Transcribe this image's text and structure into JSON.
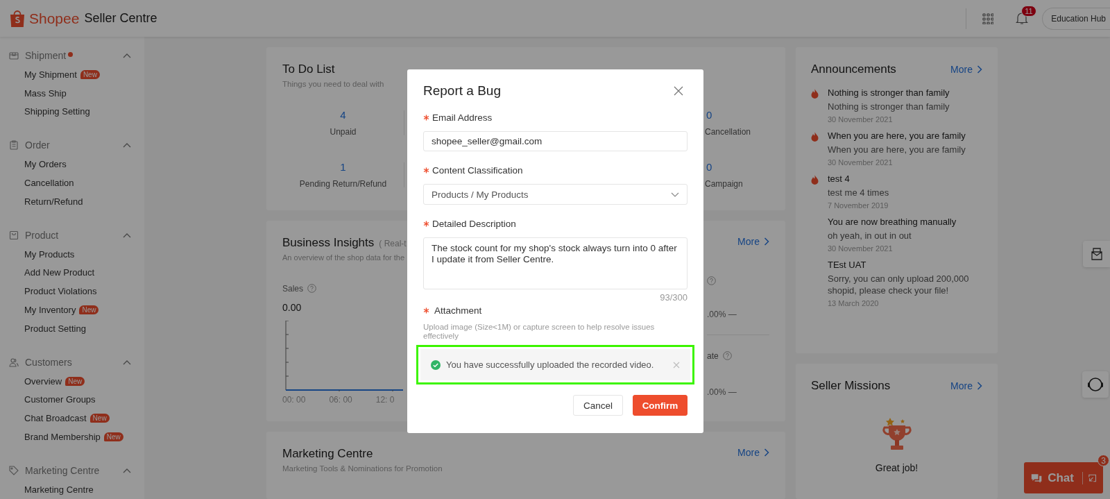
{
  "header": {
    "brand": "Shopee",
    "product": "Seller Centre",
    "notifications": "11",
    "education": "Education Hub"
  },
  "sidebar": [
    {
      "title": "Shipment",
      "dot": true,
      "expanded": true,
      "items": [
        {
          "label": "My Shipment",
          "badge": "New"
        },
        {
          "label": "Mass Ship"
        },
        {
          "label": "Shipping Setting"
        }
      ]
    },
    {
      "title": "Order",
      "dot": false,
      "expanded": true,
      "items": [
        {
          "label": "My Orders"
        },
        {
          "label": "Cancellation"
        },
        {
          "label": "Return/Refund"
        }
      ]
    },
    {
      "title": "Product",
      "dot": false,
      "expanded": true,
      "items": [
        {
          "label": "My Products"
        },
        {
          "label": "Add New Product"
        },
        {
          "label": "Product Violations"
        },
        {
          "label": "My Inventory",
          "badge": "New"
        },
        {
          "label": "Product Setting"
        }
      ]
    },
    {
      "title": "Customers",
      "dot": false,
      "expanded": true,
      "items": [
        {
          "label": "Overview",
          "badge": "New"
        },
        {
          "label": "Customer Groups"
        },
        {
          "label": "Chat Broadcast",
          "badge": "New"
        },
        {
          "label": "Brand Membership",
          "badge": "New"
        }
      ]
    },
    {
      "title": "Marketing Centre",
      "dot": false,
      "expanded": true,
      "items": [
        {
          "label": "Marketing Centre"
        }
      ]
    }
  ],
  "todo": {
    "title": "To Do List",
    "subtitle": "Things you need to deal with",
    "rows": [
      [
        {
          "value": "4",
          "label": "Unpaid"
        },
        {
          "value": "0",
          "label": "Cancellation"
        }
      ],
      [
        {
          "value": "1",
          "label": "Pending Return/Refund"
        },
        {
          "value": "0",
          "label": "Campaign"
        }
      ]
    ]
  },
  "insights": {
    "title": "Business Insights",
    "note": "( Real-t",
    "subtitle": "An overview of the shop data for the",
    "more": "More",
    "metric": "Sales",
    "metric_value": "0.00",
    "x_labels": [
      "00: 00",
      "06: 00",
      "12: 0"
    ],
    "side": [
      {
        "value": ".00% —"
      },
      {
        "label": "ate",
        "value": ".00% —"
      }
    ]
  },
  "marketing": {
    "title": "Marketing Centre",
    "subtitle": "Marketing Tools & Nominations for Promotion",
    "more": "More"
  },
  "announcements": {
    "title": "Announcements",
    "more": "More",
    "items": [
      {
        "hot": true,
        "title": "Nothing is stronger than family",
        "body": "Nothing is stronger than family",
        "date": "30 November 2021"
      },
      {
        "hot": true,
        "title": "When you are here, you are family",
        "body": "When you are here, you are family",
        "date": "30 November 2021"
      },
      {
        "hot": true,
        "title": "test 4",
        "body": "test me 4 times",
        "date": "7 November 2019"
      },
      {
        "hot": false,
        "title": "You are now breathing manually",
        "body": "oh yeah, in out in out",
        "date": "30 November 2021"
      },
      {
        "hot": false,
        "title": "TEst UAT",
        "body": "Sorry, you can only upload 200,000 shopid, please check your file!",
        "date": "13 March 2020"
      }
    ]
  },
  "missions": {
    "title": "Seller Missions",
    "more": "More",
    "message": "Great job!"
  },
  "chat": {
    "label": "Chat",
    "unread": "3"
  },
  "dialog": {
    "title": "Report a Bug",
    "fields": [
      {
        "kind": "input",
        "label": "Email Address",
        "required": true,
        "value": "shopee_seller@gmail.com"
      },
      {
        "kind": "select",
        "label": "Content Classification",
        "required": true,
        "value": "Products / My Products"
      },
      {
        "kind": "textarea",
        "label": "Detailed Description",
        "required": true,
        "value": "The stock count for my shop's stock always turn into 0 after I update it from Seller Centre.",
        "counter": "93/300"
      }
    ],
    "attachment": {
      "label": "Attachment",
      "required": true,
      "hint": "Upload image (Size<1M) or capture screen to help resolve issues effectively",
      "message": "You have successfully uploaded the recorded video.",
      "highlighted": true
    },
    "buttons": [
      {
        "kind": "secondary",
        "label": "Cancel"
      },
      {
        "kind": "primary",
        "label": "Confirm"
      }
    ]
  }
}
